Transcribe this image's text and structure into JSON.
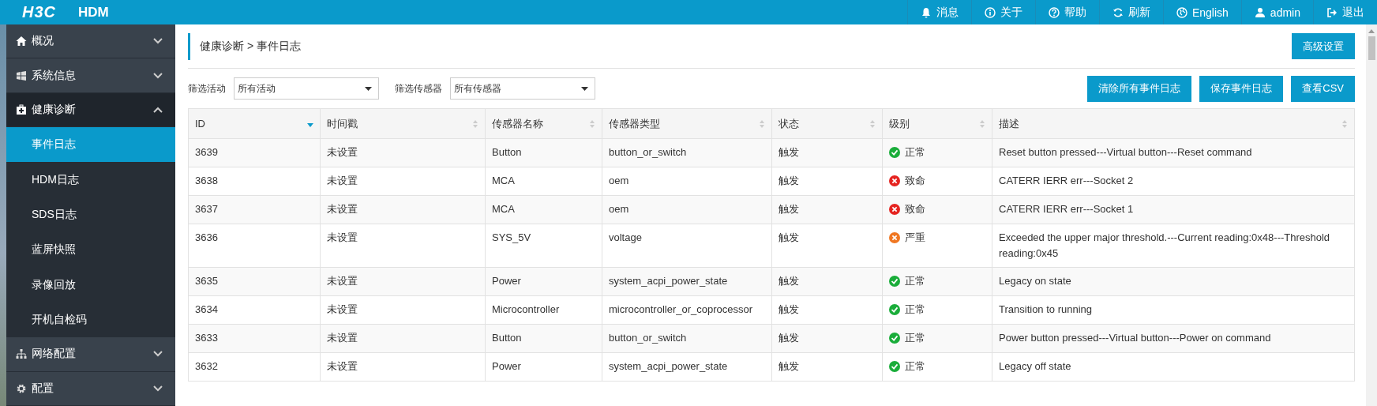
{
  "header": {
    "logo": "H3C",
    "product": "HDM",
    "nav": [
      {
        "kind": "bell",
        "label": "消息"
      },
      {
        "kind": "info",
        "label": "关于"
      },
      {
        "kind": "help",
        "label": "帮助"
      },
      {
        "kind": "refresh",
        "label": "刷新"
      },
      {
        "kind": "globe",
        "label": "English"
      },
      {
        "kind": "user",
        "label": "admin"
      },
      {
        "kind": "logout",
        "label": "退出"
      }
    ]
  },
  "sidebar": {
    "items": [
      {
        "kind": "home",
        "label": "概况",
        "expanded": false
      },
      {
        "kind": "windows",
        "label": "系统信息",
        "expanded": false
      },
      {
        "kind": "medkit",
        "label": "健康诊断",
        "expanded": true,
        "children": [
          {
            "label": "事件日志",
            "selected": true
          },
          {
            "label": "HDM日志",
            "selected": false
          },
          {
            "label": "SDS日志",
            "selected": false
          },
          {
            "label": "蓝屏快照",
            "selected": false
          },
          {
            "label": "录像回放",
            "selected": false
          },
          {
            "label": "开机自检码",
            "selected": false
          }
        ]
      },
      {
        "kind": "network",
        "label": "网络配置",
        "expanded": false
      },
      {
        "kind": "gear",
        "label": "配置",
        "expanded": false
      }
    ]
  },
  "breadcrumb": "健康诊断 > 事件日志",
  "advanced_button": "高级设置",
  "filters": [
    {
      "label": "筛选活动",
      "value": "所有活动"
    },
    {
      "label": "筛选传感器",
      "value": "所有传感器"
    }
  ],
  "actions": [
    "清除所有事件日志",
    "保存事件日志",
    "查看CSV"
  ],
  "table": {
    "columns": [
      {
        "label": "ID",
        "selected": true
      },
      {
        "label": "时间戳",
        "selected": false
      },
      {
        "label": "传感器名称",
        "selected": false
      },
      {
        "label": "传感器类型",
        "selected": false
      },
      {
        "label": "状态",
        "selected": false
      },
      {
        "label": "级别",
        "selected": false
      },
      {
        "label": "描述",
        "selected": false
      }
    ],
    "rows": [
      {
        "id": "3639",
        "time": "未设置",
        "name": "Button",
        "type": "button_or_switch",
        "state": "触发",
        "level": {
          "kind": "check",
          "color": "#1aad3a",
          "label": "正常"
        },
        "desc": "Reset button pressed---Virtual button---Reset command"
      },
      {
        "id": "3638",
        "time": "未设置",
        "name": "MCA",
        "type": "oem",
        "state": "触发",
        "level": {
          "kind": "cross",
          "color": "#e52420",
          "label": "致命"
        },
        "desc": "CATERR IERR err---Socket 2"
      },
      {
        "id": "3637",
        "time": "未设置",
        "name": "MCA",
        "type": "oem",
        "state": "触发",
        "level": {
          "kind": "cross",
          "color": "#e52420",
          "label": "致命"
        },
        "desc": "CATERR IERR err---Socket 1"
      },
      {
        "id": "3636",
        "time": "未设置",
        "name": "SYS_5V",
        "type": "voltage",
        "state": "触发",
        "level": {
          "kind": "cross",
          "color": "#f07722",
          "label": "严重"
        },
        "desc": "Exceeded the upper major threshold.---Current reading:0x48---Threshold reading:0x45"
      },
      {
        "id": "3635",
        "time": "未设置",
        "name": "Power",
        "type": "system_acpi_power_state",
        "state": "触发",
        "level": {
          "kind": "check",
          "color": "#1aad3a",
          "label": "正常"
        },
        "desc": "Legacy on state"
      },
      {
        "id": "3634",
        "time": "未设置",
        "name": "Microcontroller",
        "type": "microcontroller_or_coprocessor",
        "state": "触发",
        "level": {
          "kind": "check",
          "color": "#1aad3a",
          "label": "正常"
        },
        "desc": "Transition to running"
      },
      {
        "id": "3633",
        "time": "未设置",
        "name": "Button",
        "type": "button_or_switch",
        "state": "触发",
        "level": {
          "kind": "check",
          "color": "#1aad3a",
          "label": "正常"
        },
        "desc": "Power button pressed---Virtual button---Power on command"
      },
      {
        "id": "3632",
        "time": "未设置",
        "name": "Power",
        "type": "system_acpi_power_state",
        "state": "触发",
        "level": {
          "kind": "check",
          "color": "#1aad3a",
          "label": "正常"
        },
        "desc": "Legacy off state"
      }
    ]
  }
}
